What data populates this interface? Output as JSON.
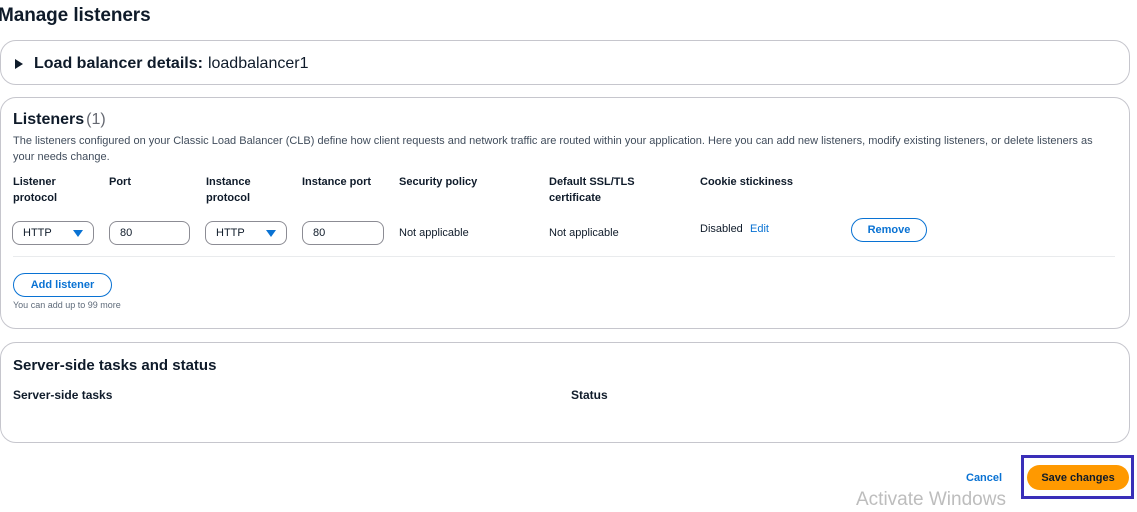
{
  "page": {
    "title": "Manage listeners"
  },
  "details": {
    "label": "Load balancer details:",
    "value": "loadbalancer1"
  },
  "listeners": {
    "title": "Listeners",
    "count": "(1)",
    "description": "The listeners configured on your Classic Load Balancer (CLB) define how client requests and network traffic are routed within your application. Here you can add new listeners, modify existing listeners, or delete listeners as your needs change.",
    "columns": {
      "listener_protocol": [
        "Listener",
        "protocol"
      ],
      "port": "Port",
      "instance_protocol": [
        "Instance",
        "protocol"
      ],
      "instance_port": "Instance port",
      "security_policy": "Security policy",
      "default_ssl": [
        "Default SSL/TLS",
        "certificate"
      ],
      "cookie_stickiness": "Cookie stickiness"
    },
    "rows": [
      {
        "listener_protocol": "HTTP",
        "port": "80",
        "instance_protocol": "HTTP",
        "instance_port": "80",
        "security_policy": "Not applicable",
        "default_ssl": "Not applicable",
        "cookie_stickiness": "Disabled",
        "edit_label": "Edit",
        "remove_label": "Remove"
      }
    ],
    "add_label": "Add listener",
    "hint": "You can add up to 99 more"
  },
  "server": {
    "title": "Server-side tasks and status",
    "col_tasks": "Server-side tasks",
    "col_status": "Status"
  },
  "footer": {
    "cancel_label": "Cancel",
    "save_label": "Save changes"
  },
  "watermark": "Activate Windows",
  "colors": {
    "primary": "#0972d3",
    "save": "#ff9900",
    "highlight_outline": "#3a2fb8"
  },
  "icons": {
    "expand": "caret-right-icon",
    "dropdown": "caret-down-icon"
  }
}
